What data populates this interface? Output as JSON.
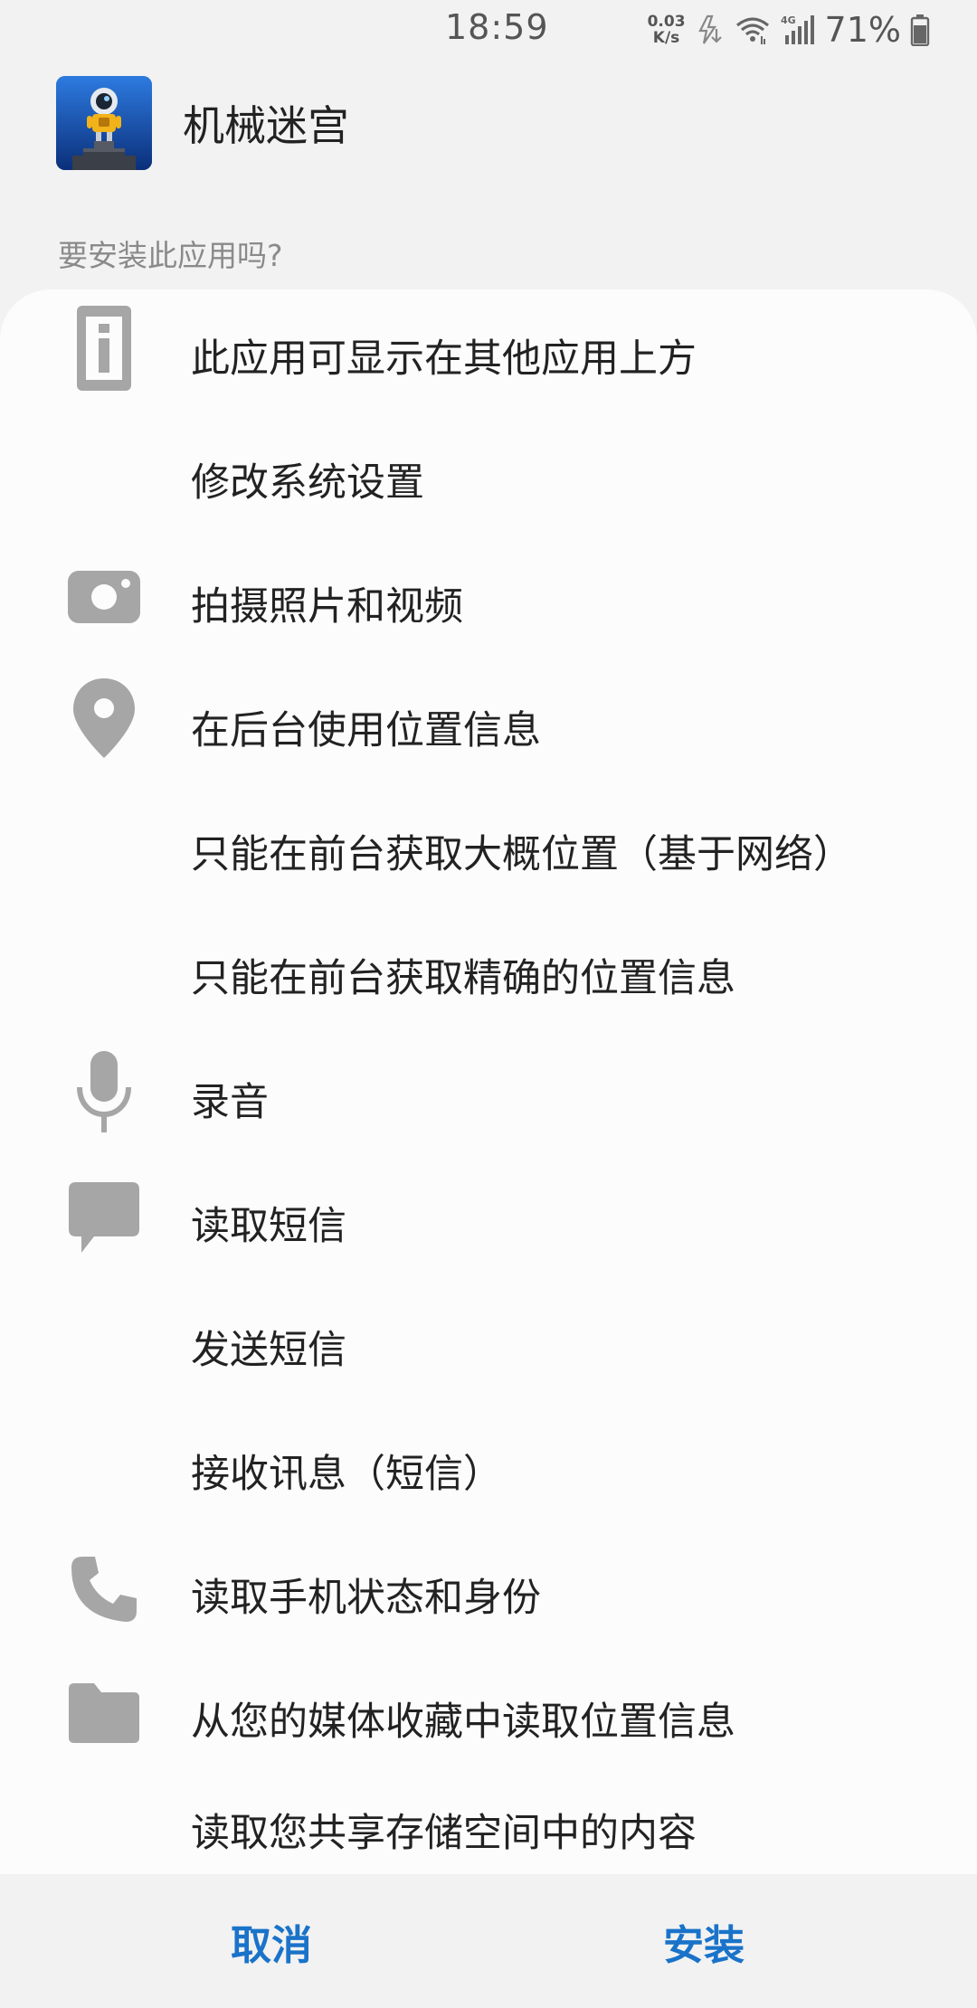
{
  "status_bar": {
    "time": "18:59",
    "net_speed_value": "0.03",
    "net_speed_unit": "K/s",
    "network_type": "4G",
    "battery_percent": "71%",
    "icons": [
      "no-charge-icon",
      "wifi-icon",
      "signal-icon",
      "battery-icon"
    ]
  },
  "app": {
    "name": "机械迷宫",
    "icon": "app-icon-robot"
  },
  "install_question": "要安装此应用吗?",
  "permissions": [
    {
      "label": "此应用可显示在其他应用上方",
      "icon": "info-icon"
    },
    {
      "label": "修改系统设置",
      "icon": ""
    },
    {
      "label": "拍摄照片和视频",
      "icon": "camera-icon"
    },
    {
      "label": "在后台使用位置信息",
      "icon": "location-icon"
    },
    {
      "label": "只能在前台获取大概位置（基于网络）",
      "icon": ""
    },
    {
      "label": "只能在前台获取精确的位置信息",
      "icon": ""
    },
    {
      "label": "录音",
      "icon": "microphone-icon"
    },
    {
      "label": "读取短信",
      "icon": "message-icon"
    },
    {
      "label": "发送短信",
      "icon": ""
    },
    {
      "label": "接收讯息（短信）",
      "icon": ""
    },
    {
      "label": "读取手机状态和身份",
      "icon": "phone-icon"
    },
    {
      "label": "从您的媒体收藏中读取位置信息",
      "icon": "folder-icon"
    },
    {
      "label": "读取您共享存储空间中的内容",
      "icon": ""
    }
  ],
  "buttons": {
    "cancel": "取消",
    "install": "安装"
  },
  "colors": {
    "accent": "#1a73c9",
    "icon_gray": "#a6a6a6",
    "background": "#f2f2f2",
    "panel": "#fcfcfc"
  }
}
